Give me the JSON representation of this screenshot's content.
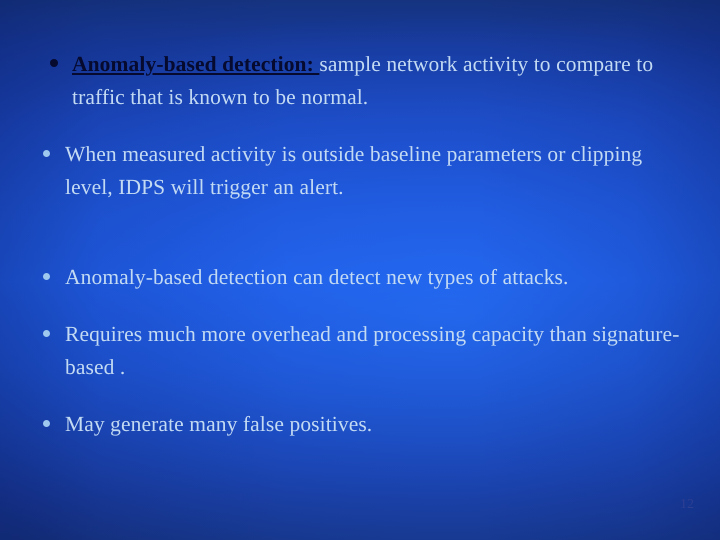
{
  "slide": {
    "page_number": "12",
    "theme": {
      "background_top": "#15337f",
      "background_mid": "#1f5ae2",
      "background_bottom": "#15317f",
      "body_text_color": "#c3daf3",
      "emphasis_text_color": "#050a2e",
      "bullet_marker_color": "#9fc8ef",
      "page_number_color": "#2c3f92"
    },
    "bullets": [
      {
        "marker": "bullet-dot-dark",
        "lead_in": "Anomaly-based detection: ",
        "text": "sample network activity to compare to traffic that is known to be normal.",
        "align": "left"
      },
      {
        "marker": "bullet-dot-light",
        "lead_in": "",
        "text": "When measured activity is outside baseline parameters or clipping level, IDPS will trigger an alert.",
        "align": "justify"
      },
      {
        "marker": "bullet-dot-light",
        "lead_in": "",
        "text": "Anomaly-based detection can detect new types of attacks.",
        "align": "left"
      },
      {
        "marker": "bullet-dot-light",
        "lead_in": "",
        "text": "Requires much more overhead and processing capacity than signature-based .",
        "align": "left"
      },
      {
        "marker": "bullet-dot-light",
        "lead_in": "",
        "text": "May generate many false positives.",
        "align": "left"
      }
    ]
  }
}
